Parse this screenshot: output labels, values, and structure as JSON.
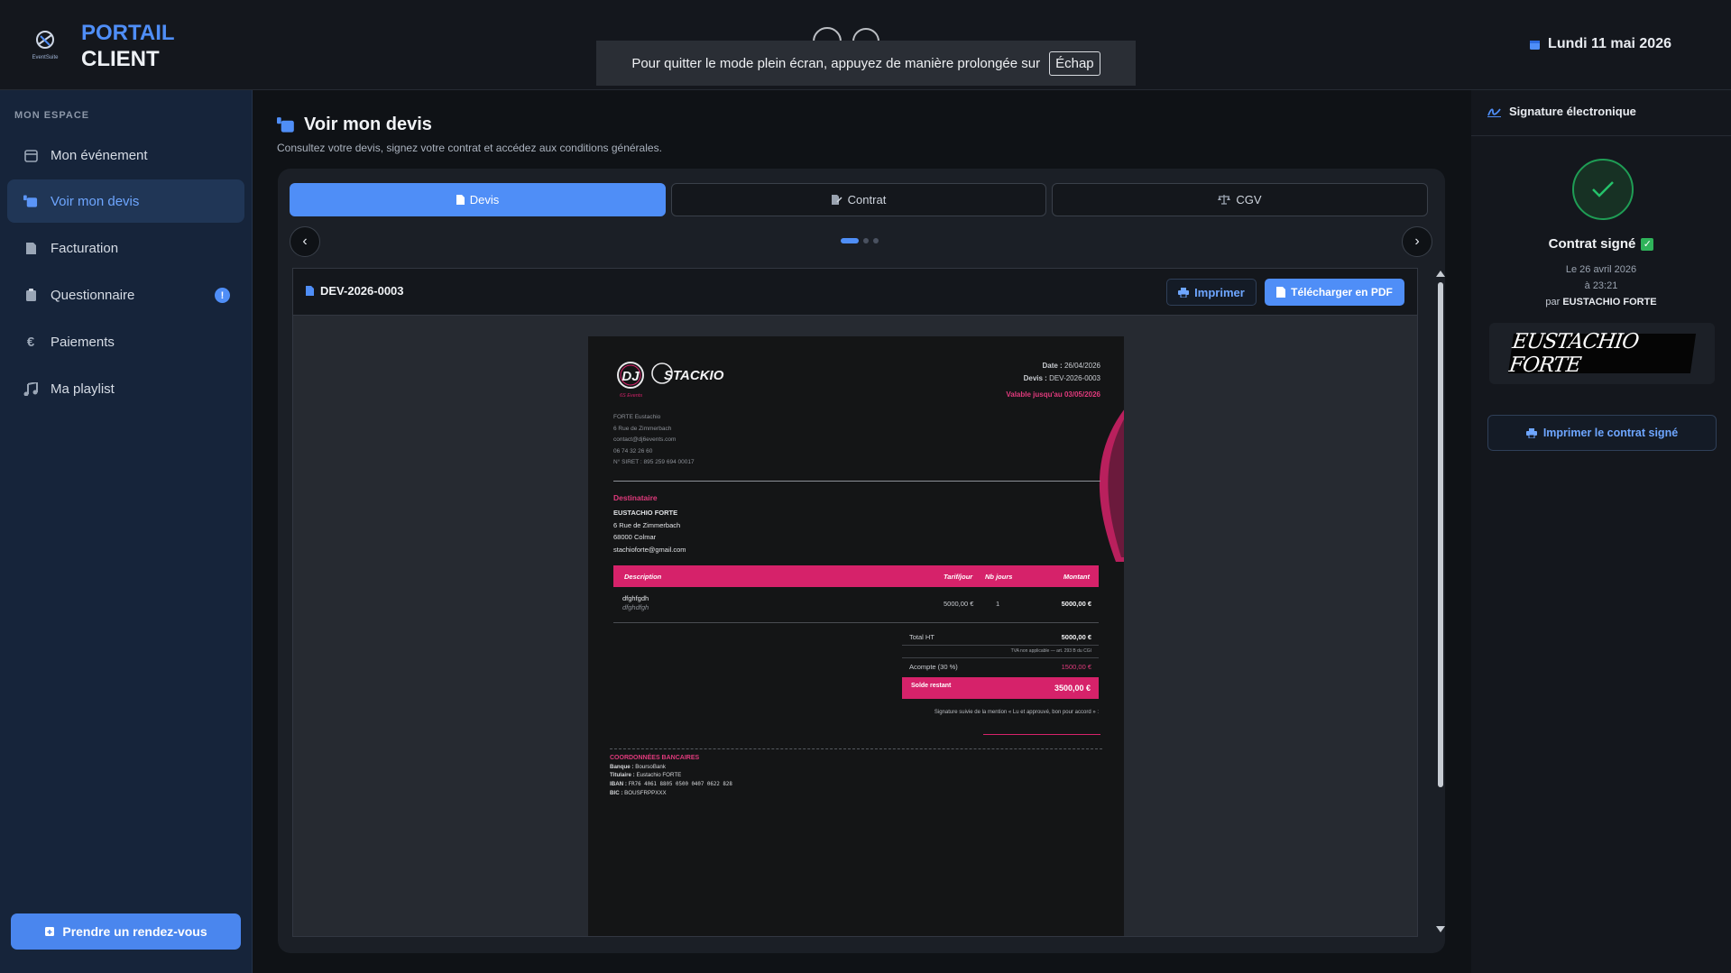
{
  "header": {
    "brand_line1": "PORTAIL",
    "brand_line2": "CLIENT",
    "logo_text": "EventSuite",
    "date": "Lundi 11 mai 2026",
    "fullscreen_notice": "Pour quitter le mode plein écran, appuyez de manière prolongée sur",
    "fullscreen_key": "Échap"
  },
  "sidebar": {
    "section_title": "MON ESPACE",
    "items": [
      {
        "label": "Mon événement",
        "icon": "calendar-icon"
      },
      {
        "label": "Voir mon devis",
        "icon": "quote-icon"
      },
      {
        "label": "Facturation",
        "icon": "invoice-icon"
      },
      {
        "label": "Questionnaire",
        "icon": "clipboard-icon",
        "badge": "!"
      },
      {
        "label": "Paiements",
        "icon": "euro-icon"
      },
      {
        "label": "Ma playlist",
        "icon": "music-icon"
      }
    ],
    "appointment_button": "Prendre un rendez-vous"
  },
  "main": {
    "title": "Voir mon devis",
    "subtitle": "Consultez votre devis, signez votre contrat et accédez aux conditions générales.",
    "tabs": [
      {
        "label": "Devis",
        "icon": "document-icon",
        "active": true
      },
      {
        "label": "Contrat",
        "icon": "signature-icon",
        "active": false
      },
      {
        "label": "CGV",
        "icon": "scale-icon",
        "active": false
      }
    ],
    "carousel_active_index": 0,
    "viewer": {
      "doc_id": "DEV-2026-0003",
      "print_label": "Imprimer",
      "download_label": "Télécharger en PDF"
    }
  },
  "document": {
    "logo_text": "STACKIO",
    "logo_sub": "DJ",
    "logo_tag": "6S Events",
    "date_label": "Date :",
    "date_value": "26/04/2026",
    "quote_label": "Devis :",
    "quote_value": "DEV-2026-0003",
    "validity": "Valable jusqu'au 03/05/2026",
    "emitter": [
      "FORTE Eustachio",
      "6 Rue de Zimmerbach",
      "contact@dj6events.com",
      "06 74 32 26 60",
      "N° SIRET : 895 259 694 00017"
    ],
    "recipient_title": "Destinataire",
    "recipient": [
      "EUSTACHIO FORTE",
      "6 Rue de Zimmerbach",
      "68000 Colmar",
      "stachioforte@gmail.com"
    ],
    "table_headers": [
      "Description",
      "Tarif/jour",
      "Nb jours",
      "Montant"
    ],
    "rows": [
      {
        "description": "dfghfgdh",
        "detail": "dfghdfgh",
        "rate": "5000,00 €",
        "days": "1",
        "amount": "5000,00 €"
      }
    ],
    "total_ht_label": "Total HT",
    "total_ht": "5000,00 €",
    "vat_note": "TVA non applicable — art. 293 B du CGI",
    "deposit_label": "Acompte (30 %)",
    "deposit": "1500,00 €",
    "balance_label": "Solde restant",
    "balance": "3500,00 €",
    "signature_note": "Signature suivie de la mention « Lu et approuvé, bon pour accord » :",
    "bank_title": "COORDONNÉES BANCAIRES",
    "bank": [
      {
        "label": "Banque :",
        "value": "BoursoBank"
      },
      {
        "label": "Titulaire :",
        "value": "Eustachio FORTE"
      },
      {
        "label": "IBAN :",
        "value": "FR76 4061 8805 0500 0407 0622 828"
      },
      {
        "label": "BIC :",
        "value": "BOUSFRPPXXX"
      }
    ],
    "accent_color": "#d6226a"
  },
  "right_panel": {
    "title": "Signature électronique",
    "status": "Contrat signé",
    "signed_date": "Le 26 avril 2026",
    "signed_time": "à 23:21",
    "signed_by_prefix": "par",
    "signed_by": "EUSTACHIO FORTE",
    "signature_text": "EUSTACHIO FORTE",
    "print_button": "Imprimer le contrat signé"
  },
  "colors": {
    "accent": "#4f8ef7",
    "sidebar_bg": "#16243a",
    "success": "#25c26a",
    "doc_pink": "#d6226a"
  }
}
